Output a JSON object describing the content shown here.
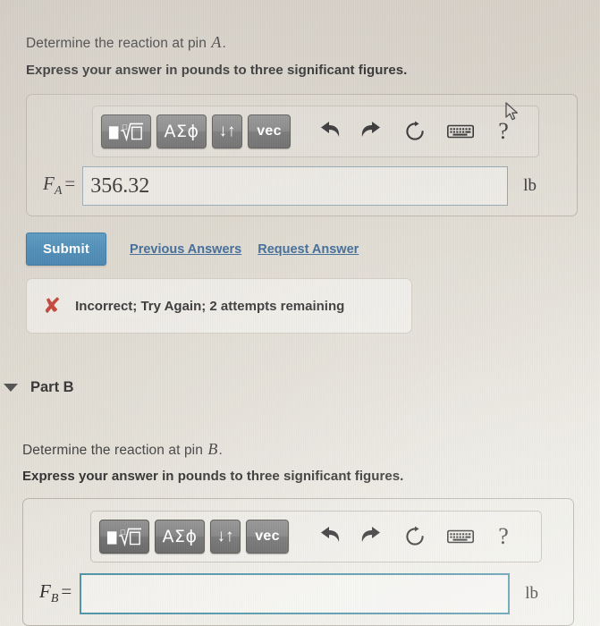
{
  "part_a": {
    "prompt_prefix": "Determine the reaction at pin ",
    "prompt_var": "A",
    "prompt_suffix": ".",
    "instruction": "Express your answer in pounds to three significant figures.",
    "toolbar": {
      "sqrt_label": "√",
      "greek_label": "ΑΣϕ",
      "arrows_label": "↓↑",
      "vec_label": "vec",
      "undo_icon": "undo-icon",
      "redo_icon": "redo-icon",
      "reset_icon": "reset-icon",
      "keyboard_icon": "keyboard-icon",
      "help_label": "?"
    },
    "input": {
      "var_main": "F",
      "var_sub": "A",
      "equals": "=",
      "value": "356.32",
      "placeholder": "",
      "unit": "lb"
    },
    "actions": {
      "submit_label": "Submit",
      "previous_answers_label": "Previous Answers",
      "request_answer_label": "Request Answer"
    },
    "feedback": {
      "icon": "x-mark-icon",
      "text": "Incorrect; Try Again; 2 attempts remaining",
      "color": "#c0392b"
    }
  },
  "part_b": {
    "caret_icon": "caret-down-icon",
    "title": "Part B",
    "prompt_prefix": "Determine the reaction at pin ",
    "prompt_var": "B",
    "prompt_suffix": ".",
    "instruction": "Express your answer in pounds to three significant figures.",
    "toolbar": {
      "sqrt_label": "√",
      "greek_label": "ΑΣϕ",
      "arrows_label": "↓↑",
      "vec_label": "vec",
      "undo_icon": "undo-icon",
      "redo_icon": "redo-icon",
      "reset_icon": "reset-icon",
      "keyboard_icon": "keyboard-icon",
      "help_label": "?"
    },
    "input": {
      "var_main": "F",
      "var_sub": "B",
      "equals": "=",
      "value": "",
      "placeholder": "",
      "unit": "lb"
    }
  },
  "colors": {
    "submit_blue": "#3f83b1",
    "link_blue": "#2f5f8f",
    "error_red": "#c0392b",
    "focus_teal": "#4e93a8",
    "key_gray": "#7f7f7f"
  }
}
